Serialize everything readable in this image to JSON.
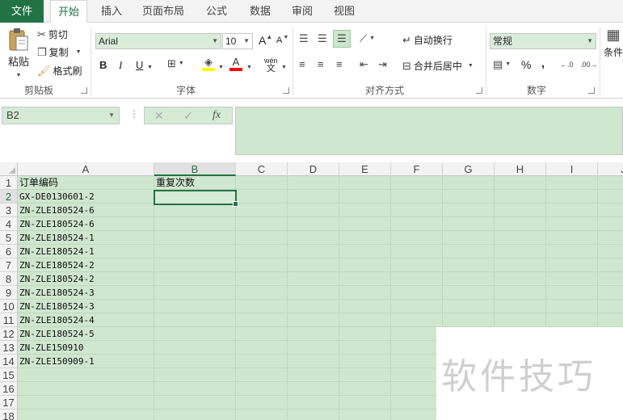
{
  "tabs": {
    "file": "文件",
    "items": [
      "开始",
      "插入",
      "页面布局",
      "公式",
      "数据",
      "审阅",
      "视图"
    ],
    "active": "开始"
  },
  "ribbon": {
    "clipboard": {
      "paste": "粘贴",
      "cut": "剪切",
      "copy": "复制",
      "format_painter": "格式刷",
      "label": "剪贴板"
    },
    "font": {
      "name": "Arial",
      "size": "10",
      "grow": "A",
      "shrink": "A",
      "bold": "B",
      "italic": "I",
      "underline": "U",
      "wen": "wén",
      "wen_char": "文",
      "label": "字体"
    },
    "alignment": {
      "wrap_text": "自动换行",
      "merge_center": "合并后居中",
      "label": "对齐方式"
    },
    "number": {
      "format": "常规",
      "percent": "%",
      "comma": ",",
      "label": "数字"
    },
    "styles": {
      "conditional": "条件"
    },
    "colors": {
      "brand": "#217346",
      "highlight": "#ffff00",
      "font_color": "#ff0000"
    }
  },
  "formula_bar": {
    "name_box": "B2",
    "cancel": "✕",
    "enter": "✓",
    "fx": "fx",
    "value": ""
  },
  "sheet": {
    "columns": [
      "A",
      "B",
      "C",
      "D",
      "E",
      "F",
      "G",
      "H",
      "I",
      "J"
    ],
    "rows": [
      "1",
      "2",
      "3",
      "4",
      "5",
      "6",
      "7",
      "8",
      "9",
      "10",
      "11",
      "12",
      "13",
      "14",
      "15",
      "16",
      "17",
      "18"
    ],
    "selected_column": "B",
    "selected_row": "2",
    "headers": {
      "a1": "订单编码",
      "b1": "重复次数"
    },
    "column_a": [
      "GX-DE0130601-2",
      "ZN-ZLE180524-6",
      "ZN-ZLE180524-6",
      "ZN-ZLE180524-1",
      "ZN-ZLE180524-1",
      "ZN-ZLE180524-2",
      "ZN-ZLE180524-2",
      "ZN-ZLE180524-3",
      "ZN-ZLE180524-3",
      "ZN-ZLE180524-4",
      "ZN-ZLE180524-5",
      "ZN-ZLE150910",
      "ZN-ZLE150909-1"
    ]
  },
  "watermark": "软件技巧"
}
